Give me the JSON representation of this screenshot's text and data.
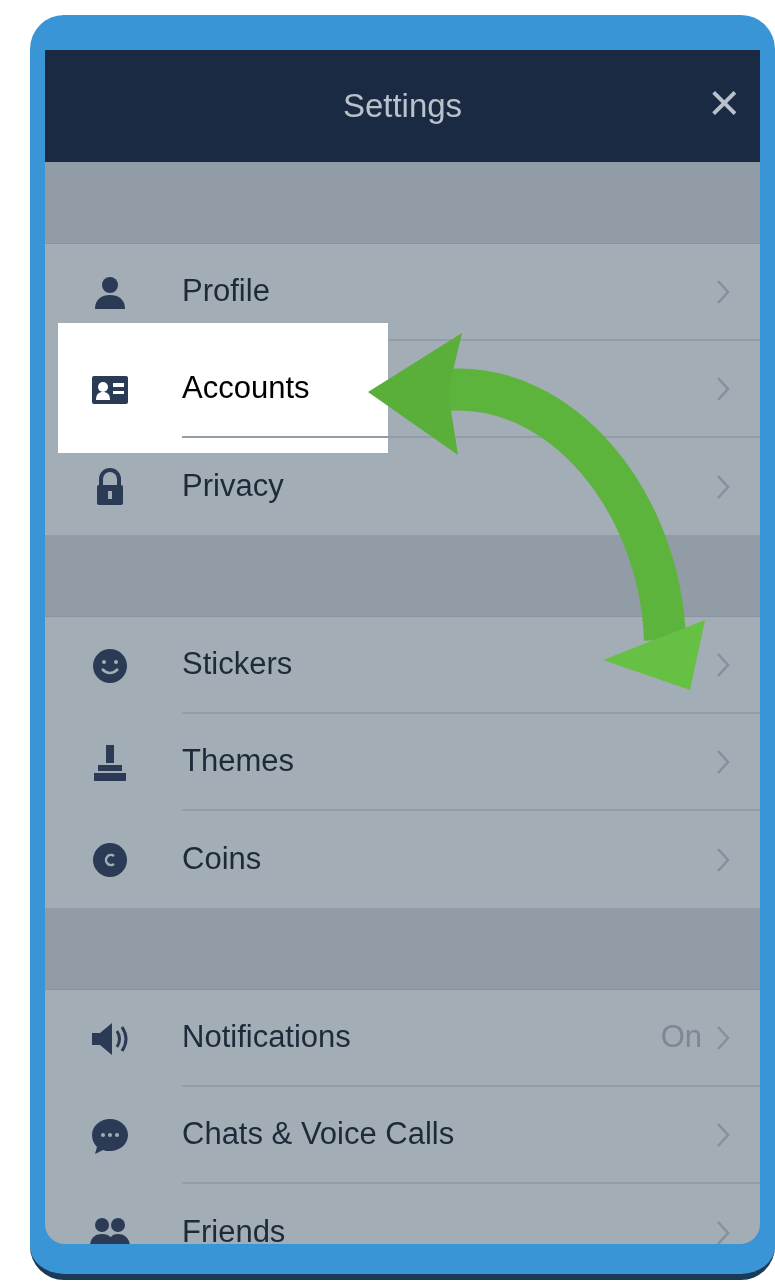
{
  "header": {
    "title": "Settings",
    "close": "×"
  },
  "sections": [
    {
      "items": [
        {
          "label": "Profile",
          "highlighted": false
        },
        {
          "label": "Accounts",
          "highlighted": true
        },
        {
          "label": "Privacy",
          "highlighted": false
        }
      ]
    },
    {
      "items": [
        {
          "label": "Stickers",
          "highlighted": false
        },
        {
          "label": "Themes",
          "highlighted": false
        },
        {
          "label": "Coins",
          "highlighted": false
        }
      ]
    },
    {
      "items": [
        {
          "label": "Notifications",
          "value": "On",
          "highlighted": false
        },
        {
          "label": "Chats & Voice Calls",
          "highlighted": false
        },
        {
          "label": "Friends",
          "highlighted": false
        }
      ]
    }
  ]
}
